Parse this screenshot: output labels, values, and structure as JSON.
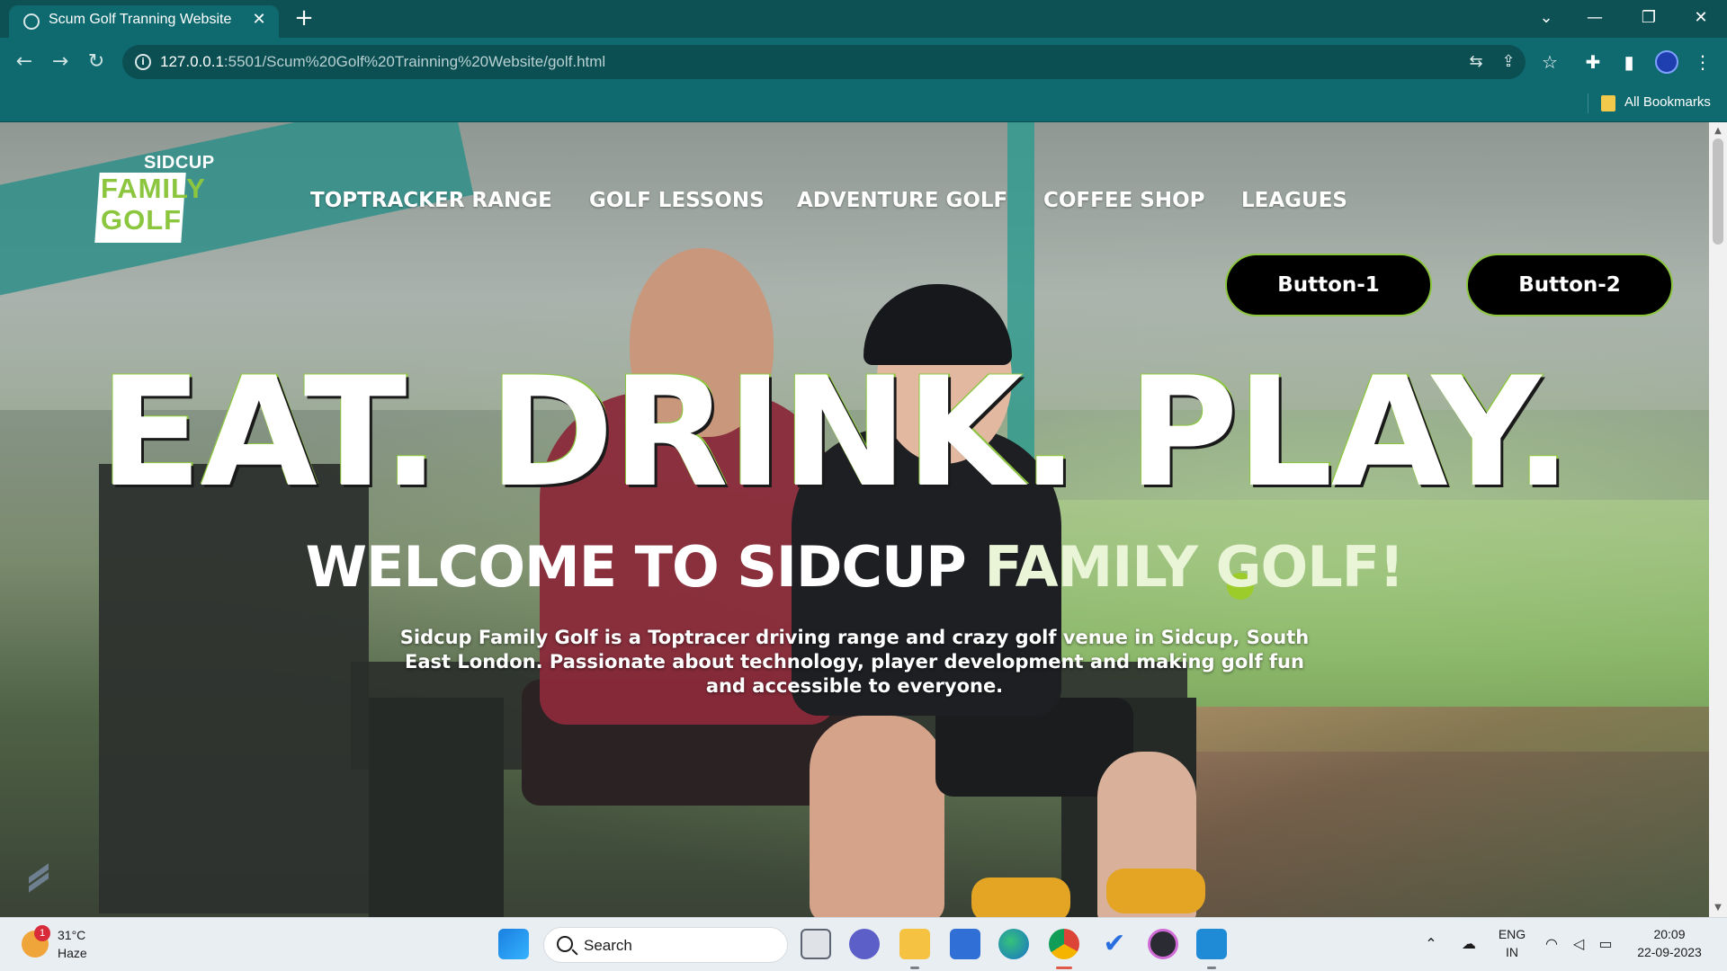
{
  "browser": {
    "tab_title": "Scum Golf Tranning Website",
    "url_host": "127.0.0.1",
    "url_rest": ":5501/Scum%20Golf%20Trainning%20Website/golf.html",
    "bookmarks_label": "All Bookmarks"
  },
  "site": {
    "logo": {
      "line1": "SIDCUP",
      "line2": "FAMILY",
      "line3": "GOLF"
    },
    "nav": [
      "TOPTRACKER RANGE",
      "GOLF LESSONS",
      "ADVENTURE GOLF",
      "COFFEE SHOP",
      "LEAGUES"
    ],
    "buttons": [
      "Button-1",
      "Button-2"
    ],
    "headline": "EAT. DRINK. PLAY.",
    "welcome_part1": "WELCOME TO SIDCUP ",
    "welcome_part2": "FAMILY GOLF!",
    "intro": "Sidcup Family Golf is a Toptracer driving range and crazy golf venue in Sidcup, South East London. Passionate about technology, player development and making golf fun and accessible to everyone.",
    "colors": {
      "accent_green": "#8cc63f",
      "button_bg": "#000000",
      "browser_teal": "#0f6a70"
    }
  },
  "taskbar": {
    "weather_temp": "31°C",
    "weather_cond": "Haze",
    "weather_badge": "1",
    "search_label": "Search",
    "lang_line1": "ENG",
    "lang_line2": "IN",
    "time": "20:09",
    "date": "22-09-2023"
  }
}
